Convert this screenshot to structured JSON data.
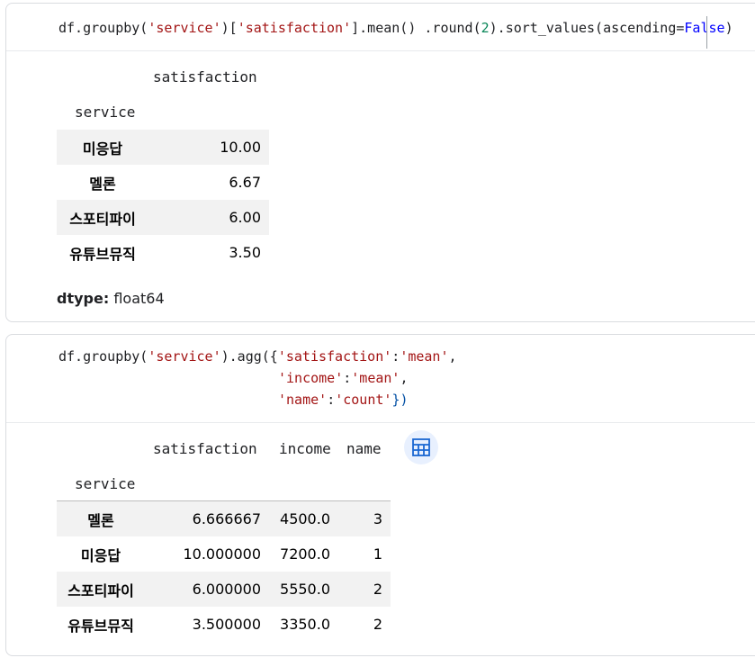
{
  "cell1": {
    "code": {
      "l1": "df.groupby(",
      "s1": "'service'",
      "l2": ")[",
      "s2": "'satisfaction'",
      "l3": "].mean() .round(",
      "n1": "2",
      "l4": ").sort_values(ascending=",
      "k1": "False",
      "l5": ")"
    },
    "output": {
      "column_header": "satisfaction",
      "index_name": "service",
      "rows": [
        {
          "service": "미응답",
          "satisfaction": "10.00"
        },
        {
          "service": "멜론",
          "satisfaction": "6.67"
        },
        {
          "service": "스포티파이",
          "satisfaction": "6.00"
        },
        {
          "service": "유튜브뮤직",
          "satisfaction": "3.50"
        }
      ],
      "dtype_label": "dtype:",
      "dtype_value": "float64"
    }
  },
  "cell2": {
    "code": {
      "line1_a": "df.groupby(",
      "line1_s1": "'service'",
      "line1_b": ").agg({",
      "line1_s2": "'satisfaction'",
      "line1_c": ":",
      "line1_s3": "'mean'",
      "line1_d": ",",
      "line2_s1": "'income'",
      "line2_c": ":",
      "line2_s2": "'mean'",
      "line2_d": ",",
      "line3_s1": "'name'",
      "line3_c": ":",
      "line3_s2": "'count'",
      "line3_d": "})"
    },
    "output": {
      "columns": [
        "satisfaction",
        "income",
        "name"
      ],
      "index_name": "service",
      "rows": [
        {
          "service": "멜론",
          "satisfaction": "6.666667",
          "income": "4500.0",
          "name": "3"
        },
        {
          "service": "미응답",
          "satisfaction": "10.000000",
          "income": "7200.0",
          "name": "1"
        },
        {
          "service": "스포티파이",
          "satisfaction": "6.000000",
          "income": "5550.0",
          "name": "2"
        },
        {
          "service": "유튜브뮤직",
          "satisfaction": "3.500000",
          "income": "3350.0",
          "name": "2"
        }
      ],
      "table_button_icon": "table-icon"
    }
  },
  "colors": {
    "string": "#a31515",
    "paren": "#0451a5",
    "number": "#098658",
    "keyword": "#0000ff",
    "row_stripe": "#f2f2f2",
    "table_button_bg": "#e8f0fe",
    "table_button_icon": "#1967d2"
  }
}
